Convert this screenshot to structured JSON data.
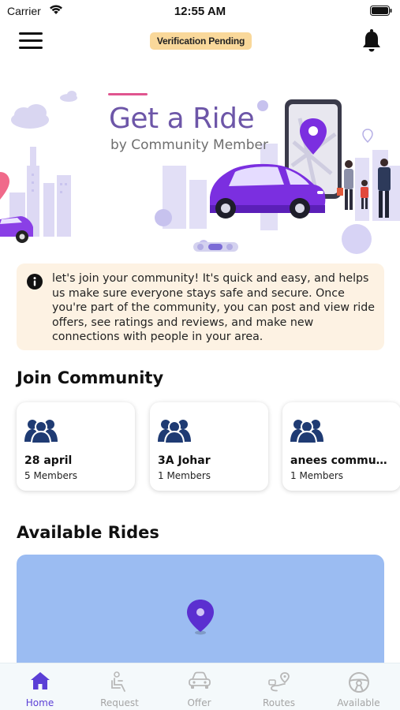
{
  "status_bar": {
    "carrier": "Carrier",
    "time": "12:55 AM"
  },
  "header": {
    "badge": "Verification Pending"
  },
  "banner": {
    "title": "Get a Ride",
    "subtitle": "by Community Member",
    "slides": 3,
    "active_slide": 2
  },
  "info": {
    "text": "let's join your community! It's quick and easy, and helps us make sure everyone stays safe and secure. Once you're part of the community, you can post and view ride offers, see ratings and reviews, and make new connections with people in your area."
  },
  "join_community": {
    "title": "Join Community",
    "cards": [
      {
        "name": "28 april",
        "members": "5 Members"
      },
      {
        "name": "3A Johar",
        "members": "1 Members"
      },
      {
        "name": "anees community",
        "members": "1 Members"
      }
    ]
  },
  "available_rides": {
    "title": "Available Rides"
  },
  "bottom_nav": {
    "items": [
      {
        "label": "Home",
        "icon": "home-icon",
        "active": true
      },
      {
        "label": "Request",
        "icon": "seat-icon",
        "active": false
      },
      {
        "label": "Offer",
        "icon": "car-icon",
        "active": false
      },
      {
        "label": "Routes",
        "icon": "route-icon",
        "active": false
      },
      {
        "label": "Available",
        "icon": "steering-wheel-icon",
        "active": false
      }
    ]
  },
  "colors": {
    "accent": "#5b3fd6",
    "banner_title": "#6d56a8",
    "badge_bg": "#f9d89a",
    "info_bg": "#fdf2e3",
    "map_bg": "#9bbcf2",
    "car_purple": "#7b2fe0",
    "card_icon": "#1f3b73"
  }
}
